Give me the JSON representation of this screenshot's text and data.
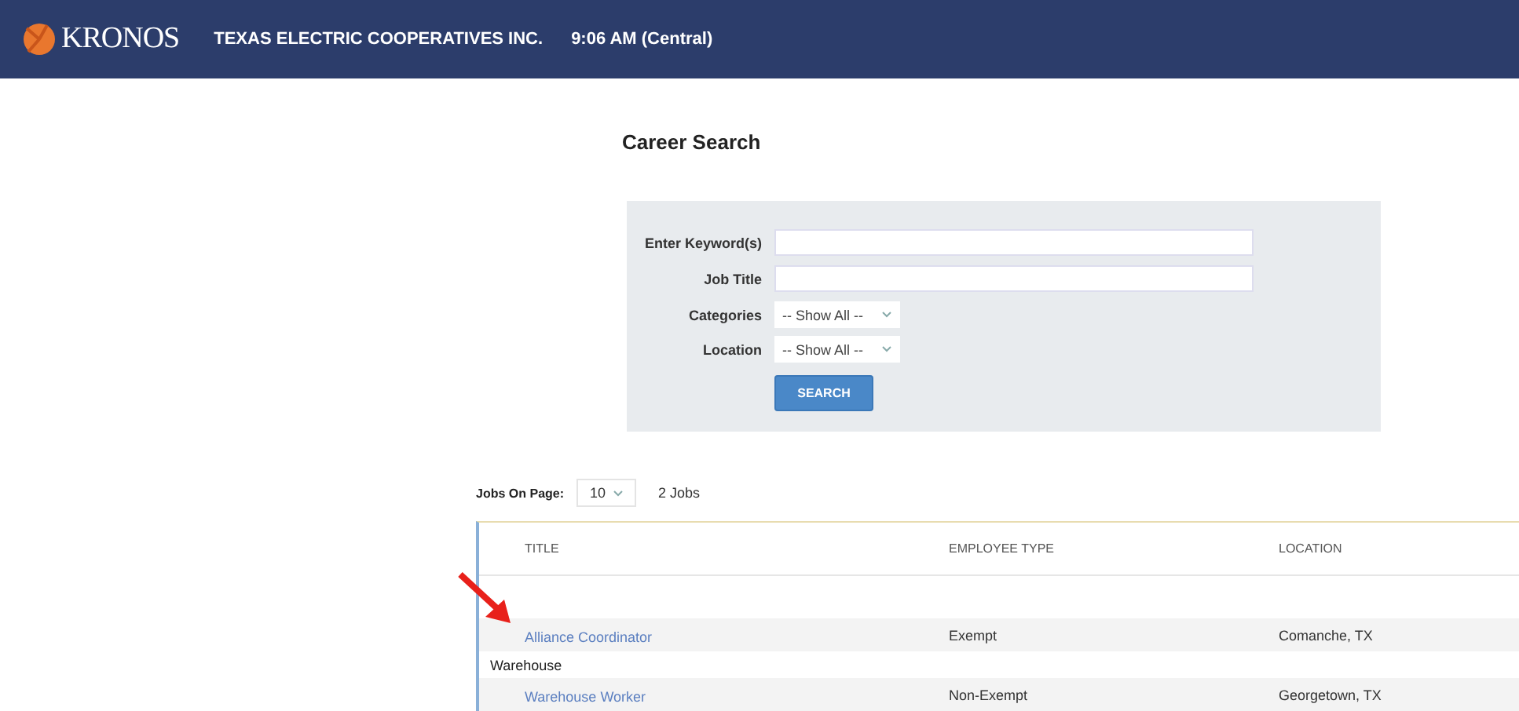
{
  "header": {
    "brand": "KRONOS",
    "company": "TEXAS ELECTRIC COOPERATIVES INC.",
    "time": "9:06 AM (Central)"
  },
  "page_title": "Career Search",
  "search_form": {
    "fields": [
      {
        "kind": "text",
        "label": "Enter Keyword(s)"
      },
      {
        "kind": "text",
        "label": "Job Title"
      },
      {
        "kind": "select",
        "label": "Categories",
        "value": "-- Show All --"
      },
      {
        "kind": "select",
        "label": "Location",
        "value": "-- Show All --"
      }
    ],
    "button": "SEARCH"
  },
  "paging": {
    "label": "Jobs On Page:",
    "value": "10",
    "count": "2 Jobs"
  },
  "table": {
    "columns": [
      "TITLE",
      "EMPLOYEE TYPE",
      "LOCATION"
    ],
    "groups": [
      {
        "rows": [
          {
            "title": "Alliance Coordinator",
            "employee_type": "Exempt",
            "location": "Comanche, TX"
          }
        ]
      },
      {
        "label": "Warehouse",
        "rows": [
          {
            "title": "Warehouse Worker",
            "employee_type": "Non-Exempt",
            "location": "Georgetown, TX"
          }
        ]
      }
    ]
  }
}
